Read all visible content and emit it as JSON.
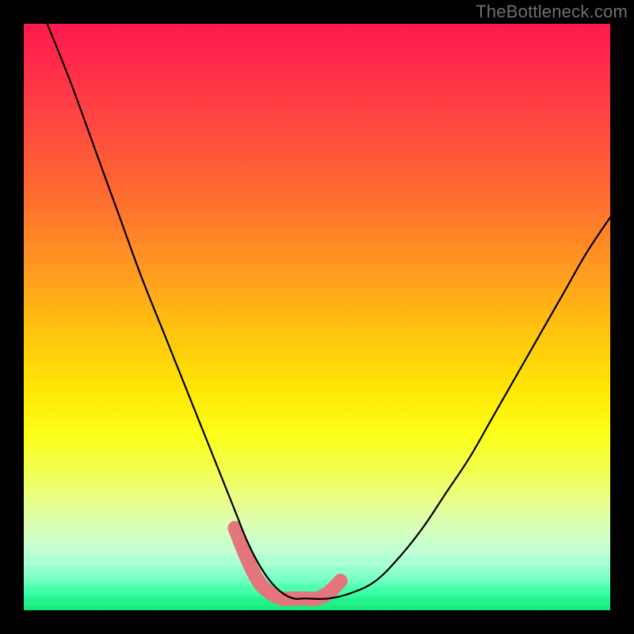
{
  "watermark": "TheBottleneck.com",
  "chart_data": {
    "type": "line",
    "title": "",
    "xlabel": "",
    "ylabel": "",
    "xlim": [
      0,
      100
    ],
    "ylim": [
      0,
      100
    ],
    "grid": false,
    "legend": false,
    "series": [
      {
        "name": "bottleneck-curve",
        "x": [
          4,
          8,
          12,
          16,
          20,
          24,
          28,
          30,
          32,
          34,
          36,
          38,
          40,
          42,
          44,
          46,
          48,
          52,
          56,
          60,
          64,
          68,
          72,
          76,
          80,
          84,
          88,
          92,
          96,
          100
        ],
        "y": [
          100,
          90,
          79,
          68,
          57,
          47,
          37,
          32,
          27,
          22,
          17,
          12,
          8,
          5,
          3,
          2,
          2,
          2,
          3,
          5,
          9,
          14,
          20,
          26,
          33,
          40,
          47,
          54,
          61,
          67
        ]
      }
    ],
    "highlight": {
      "name": "optimal-range",
      "x": [
        36,
        38,
        40,
        42,
        44,
        46,
        48,
        50,
        52,
        54
      ],
      "y": [
        14,
        9,
        5,
        3,
        2,
        2,
        2,
        2,
        3,
        5
      ],
      "color": "#e5757c"
    },
    "background_gradient": {
      "top": "#ff1a4e",
      "mid": "#ffe505",
      "bottom": "#14e877"
    }
  }
}
